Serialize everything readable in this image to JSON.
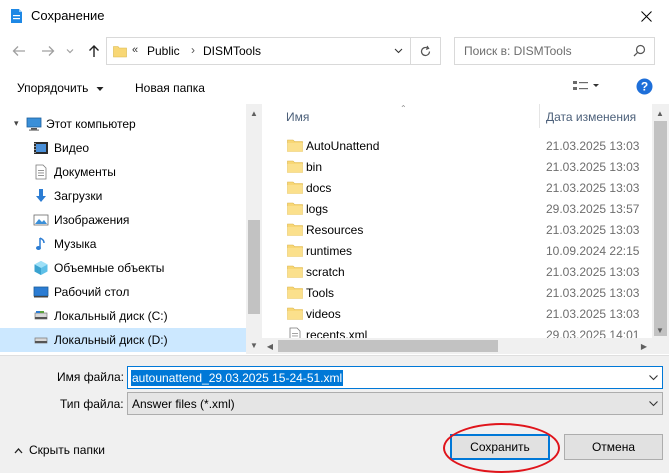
{
  "window": {
    "title": "Сохранение"
  },
  "navigation": {
    "path": [
      "Public",
      "DISMTools"
    ],
    "overflow_marker": "«",
    "search_placeholder": "Поиск в: DISMTools"
  },
  "toolbar": {
    "organize_label": "Упорядочить",
    "new_folder_label": "Новая папка"
  },
  "nav_pane": {
    "items": [
      {
        "label": "Этот компьютер",
        "icon": "computer-icon"
      },
      {
        "label": "Видео",
        "icon": "video-icon"
      },
      {
        "label": "Документы",
        "icon": "documents-icon"
      },
      {
        "label": "Загрузки",
        "icon": "downloads-icon"
      },
      {
        "label": "Изображения",
        "icon": "pictures-icon"
      },
      {
        "label": "Музыка",
        "icon": "music-icon"
      },
      {
        "label": "Объемные объекты",
        "icon": "3d-objects-icon"
      },
      {
        "label": "Рабочий стол",
        "icon": "desktop-icon"
      },
      {
        "label": "Локальный диск (C:)",
        "icon": "drive-icon"
      },
      {
        "label": "Локальный диск (D:)",
        "icon": "drive-icon",
        "selected": true
      }
    ]
  },
  "file_list": {
    "columns": {
      "name": "Имя",
      "date": "Дата изменения"
    },
    "rows": [
      {
        "name": "AutoUnattend",
        "date": "21.03.2025 13:03",
        "type": "folder"
      },
      {
        "name": "bin",
        "date": "21.03.2025 13:03",
        "type": "folder"
      },
      {
        "name": "docs",
        "date": "21.03.2025 13:03",
        "type": "folder"
      },
      {
        "name": "logs",
        "date": "29.03.2025 13:57",
        "type": "folder"
      },
      {
        "name": "Resources",
        "date": "21.03.2025 13:03",
        "type": "folder"
      },
      {
        "name": "runtimes",
        "date": "10.09.2024 22:15",
        "type": "folder"
      },
      {
        "name": "scratch",
        "date": "21.03.2025 13:03",
        "type": "folder"
      },
      {
        "name": "Tools",
        "date": "21.03.2025 13:03",
        "type": "folder"
      },
      {
        "name": "videos",
        "date": "21.03.2025 13:03",
        "type": "folder"
      },
      {
        "name": "recents.xml",
        "date": "29.03.2025 14:01",
        "type": "file"
      }
    ]
  },
  "form": {
    "filename_label": "Имя файла:",
    "filename_value": "autounattend_29.03.2025 15-24-51.xml",
    "filetype_label": "Тип файла:",
    "filetype_value": "Answer files (*.xml)"
  },
  "footer": {
    "hide_folders_label": "Скрыть папки",
    "save_label": "Сохранить",
    "cancel_label": "Отмена"
  },
  "colors": {
    "accent": "#0078d7",
    "selection": "#cce8ff",
    "annotation": "#e0141b",
    "folder": "#f8d775"
  }
}
